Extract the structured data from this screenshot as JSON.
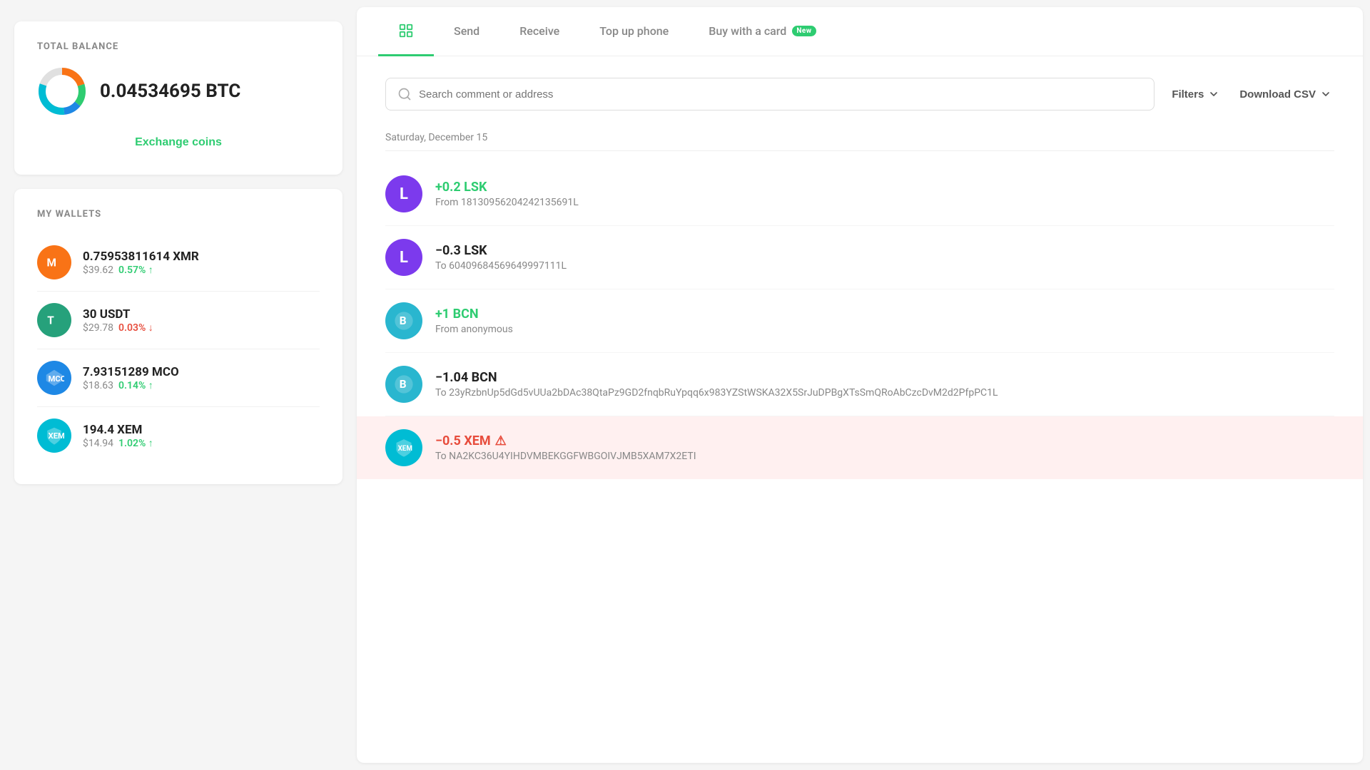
{
  "left": {
    "balance": {
      "label": "TOTAL BALANCE",
      "amount": "0.04534695 BTC",
      "exchange_label": "Exchange coins"
    },
    "wallets": {
      "label": "MY WALLETS",
      "items": [
        {
          "id": "xmr",
          "amount": "0.75953811614 XMR",
          "usd": "$39.62",
          "change": "0.57%",
          "direction": "up",
          "icon_letter": "M",
          "icon_color": "#f97316"
        },
        {
          "id": "usdt",
          "amount": "30 USDT",
          "usd": "$29.78",
          "change": "0.03%",
          "direction": "down",
          "icon_letter": "T",
          "icon_color": "#26a17b"
        },
        {
          "id": "mco",
          "amount": "7.93151289 MCO",
          "usd": "$18.63",
          "change": "0.14%",
          "direction": "up",
          "icon_letter": "M",
          "icon_color": "#1e88e5"
        },
        {
          "id": "xem",
          "amount": "194.4 XEM",
          "usd": "$14.94",
          "change": "1.02%",
          "direction": "up",
          "icon_letter": "X",
          "icon_color": "#00bcd4"
        }
      ]
    }
  },
  "right": {
    "tabs": [
      {
        "id": "history",
        "label": "",
        "icon": "history",
        "active": true
      },
      {
        "id": "send",
        "label": "Send",
        "active": false
      },
      {
        "id": "receive",
        "label": "Receive",
        "active": false
      },
      {
        "id": "topup",
        "label": "Top up phone",
        "active": false
      },
      {
        "id": "buycard",
        "label": "Buy with a card",
        "badge": "New",
        "active": false
      }
    ],
    "search": {
      "placeholder": "Search comment or address"
    },
    "filters_label": "Filters",
    "csv_label": "Download CSV",
    "date_separator": "Saturday, December 15",
    "transactions": [
      {
        "id": "tx1",
        "amount": "+0.2 LSK",
        "type": "positive",
        "description": "From 18130956204242135691L",
        "avatar_letter": "L",
        "avatar_color": "#7c3aed",
        "error": false
      },
      {
        "id": "tx2",
        "amount": "−0.3 LSK",
        "type": "negative",
        "description": "To 60409684569649997111L",
        "avatar_letter": "L",
        "avatar_color": "#7c3aed",
        "error": false
      },
      {
        "id": "tx3",
        "amount": "+1 BCN",
        "type": "positive",
        "description": "From anonymous",
        "avatar_letter": "B",
        "avatar_color": "#29b6cf",
        "error": false
      },
      {
        "id": "tx4",
        "amount": "−1.04 BCN",
        "type": "negative",
        "description": "To 23yRzbnUp5dGd5vUUa2bDAc38QtaPz9GD2fnqbRuYpqq6x983YZStWSKA32X5SrJuDPBgXTsSmQRoAbCzcDvM2d2PfpPC1L",
        "avatar_letter": "B",
        "avatar_color": "#29b6cf",
        "error": false
      },
      {
        "id": "tx5",
        "amount": "−0.5 XEM",
        "type": "error",
        "description": "To NA2KC36U4YIHDVMBEKGGFWBGOIVJMB5XAM7X2ETI",
        "avatar_letter": "X",
        "avatar_color": "#00bcd4",
        "error": true,
        "warning": true
      }
    ]
  }
}
